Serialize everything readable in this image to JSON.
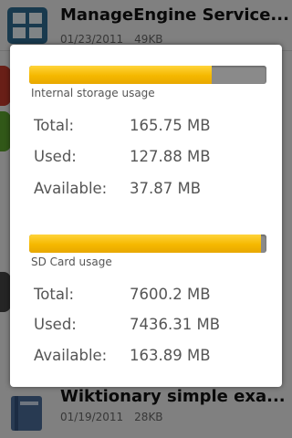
{
  "background_list": {
    "items": [
      {
        "title": "ManageEngine Service...",
        "date": "01/23/2011",
        "size": "49KB"
      },
      {
        "title": "Wiktionary simple exa...",
        "date": "01/19/2011",
        "size": "28KB"
      }
    ]
  },
  "dialog": {
    "internal": {
      "label": "Internal storage usage",
      "used_fraction": 0.771,
      "rows": [
        {
          "key": "Total:",
          "value": "165.75 MB"
        },
        {
          "key": "Used:",
          "value": "127.88 MB"
        },
        {
          "key": "Available:",
          "value": "37.87 MB"
        }
      ]
    },
    "sdcard": {
      "label": "SD Card usage",
      "used_fraction": 0.978,
      "rows": [
        {
          "key": "Total:",
          "value": "7600.2 MB"
        },
        {
          "key": "Used:",
          "value": "7436.31 MB"
        },
        {
          "key": "Available:",
          "value": "163.89 MB"
        }
      ]
    }
  },
  "colors": {
    "bar_fill": "#f5b800",
    "bar_track": "#8a8a8a"
  }
}
